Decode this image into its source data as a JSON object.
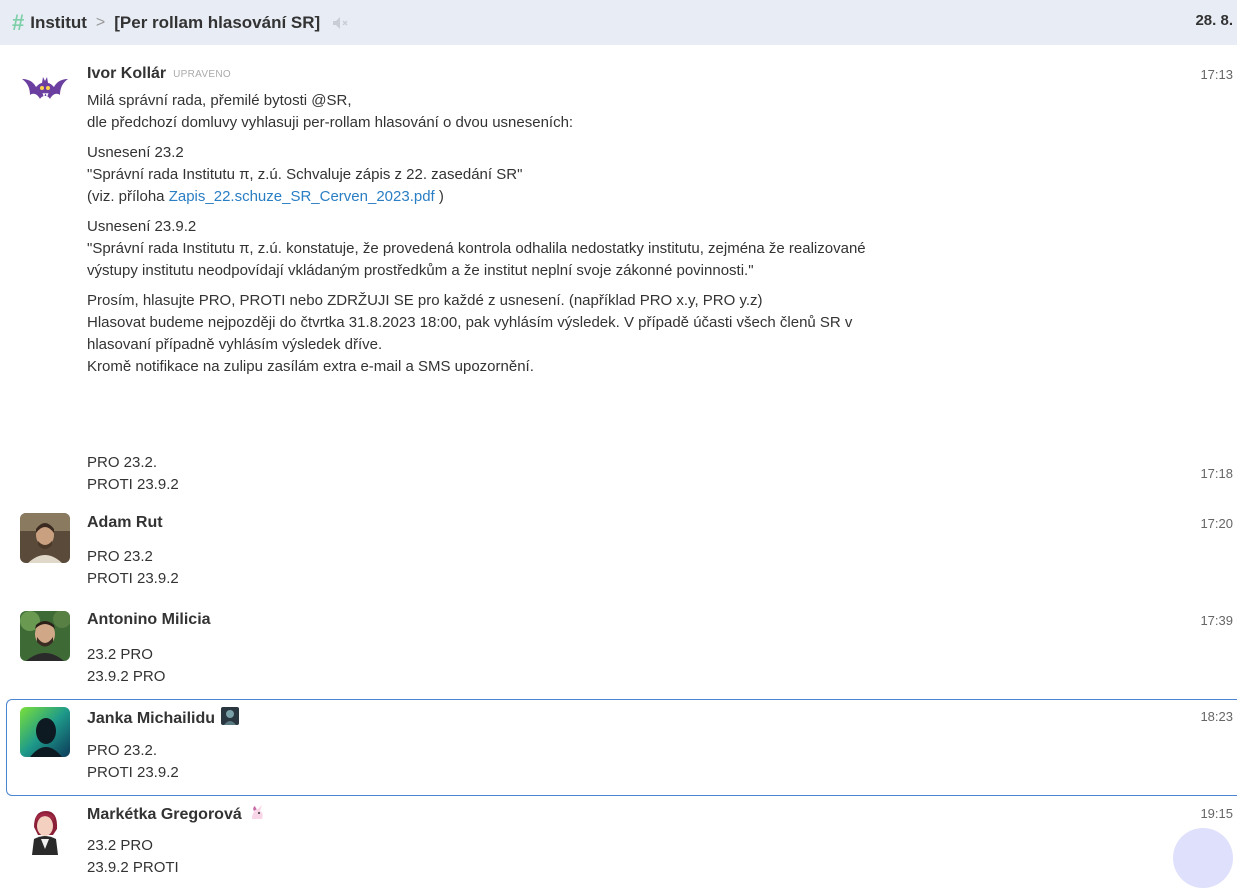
{
  "header": {
    "stream": "Institut",
    "topic": "[Per rollam hlasování SR]",
    "date": "28. 8."
  },
  "messages": [
    {
      "sender": "Ivor Kollár",
      "edited": "UPRAVENO",
      "time": "17:13",
      "p1": [
        "Milá správní rada, přemilé bytosti @SR,",
        "dle předchozí domluvy vyhlasuji per-rollam hlasování o dvou usneseních:"
      ],
      "p2": [
        "Usnesení 23.2",
        "\"Správní rada Institutu π, z.ú. Schvaluje zápis z 22. zasedání SR\""
      ],
      "p2_prefix": "(viz. příloha ",
      "p2_link": "Zapis_22.schuze_SR_Cerven_2023.pdf",
      "p2_suffix": ")",
      "p3": [
        "Usnesení 23.9.2",
        "\"Správní rada Institutu π, z.ú. konstatuje, že provedená kontrola odhalila nedostatky institutu, zejména že realizované",
        "výstupy institutu neodpovídají vkládaným prostředkům a že institut neplní svoje zákonné povinnosti.\""
      ],
      "p4": [
        "Prosím, hlasujte PRO, PROTI nebo ZDRŽUJI SE pro každé z usnesení. (například PRO x.y, PRO y.z)",
        "Hlasovat budeme nejpozději do čtvrtka 31.8.2023 18:00, pak vyhlásím výsledek. V případě účasti všech členů SR v",
        "hlasovaní případně vyhlásím výsledek dříve.",
        "Kromě notifikace na zulipu zasílám extra e-mail a SMS upozornění."
      ]
    },
    {
      "time": "17:18",
      "lines": [
        "PRO 23.2.",
        "PROTI 23.9.2"
      ]
    },
    {
      "sender": "Adam Rut",
      "time": "17:20",
      "lines": [
        "PRO 23.2",
        "PROTI 23.9.2"
      ]
    },
    {
      "sender": "Antonino Milicia",
      "time": "17:39",
      "lines": [
        "23.2 PRO",
        "23.9.2 PRO"
      ]
    },
    {
      "sender": "Janka Michailidu",
      "time": "18:23",
      "lines": [
        "PRO 23.2.",
        "PROTI 23.9.2"
      ]
    },
    {
      "sender": "Markétka Gregorová",
      "time": "19:15",
      "lines": [
        "23.2 PRO",
        "23.9.2 PROTI"
      ]
    }
  ],
  "icons": {
    "stream": "hash-icon",
    "mute": "speaker-muted-icon",
    "ivor_avatar": "bat-avatar",
    "janka_badge": "profile-emoji",
    "marketka_badge": "unicorn-emoji"
  },
  "colors": {
    "header_bg": "#e8edf5",
    "hash": "#7fcfa8",
    "link": "#2a7ec3",
    "selected_border": "#4a86d0"
  }
}
